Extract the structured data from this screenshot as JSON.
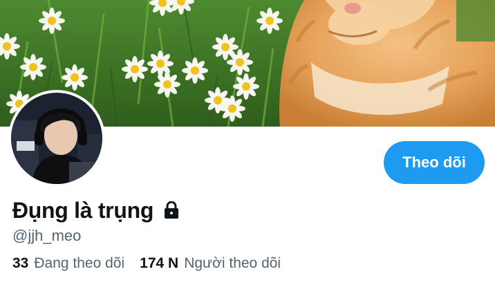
{
  "profile": {
    "display_name": "Đụng là trụng",
    "handle": "@jjh_meo",
    "locked_icon": "lock-icon",
    "follow_button_label": "Theo dõi",
    "following_count": "33",
    "following_label": "Đang theo dõi",
    "followers_count": "174 N",
    "followers_label": "Người theo dõi"
  },
  "colors": {
    "accent": "#1d9bf0",
    "text_primary": "#0f1419",
    "text_secondary": "#536471"
  }
}
